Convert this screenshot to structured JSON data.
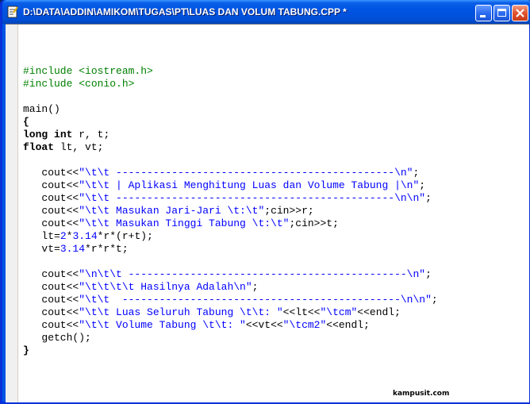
{
  "window": {
    "title": "D:\\DATA\\ADDIN\\AMIKOM\\TUGAS\\PT\\LUAS DAN VOLUM TABUNG.CPP *"
  },
  "titlebar_buttons": {
    "minimize": "minimize-icon",
    "maximize": "maximize-icon",
    "close": "close-icon"
  },
  "code_lines": [
    [
      {
        "t": "#include <iostream.h>",
        "c": "pp"
      }
    ],
    [
      {
        "t": "#include <conio.h>",
        "c": "pp"
      }
    ],
    [],
    [
      {
        "t": "main()",
        "c": ""
      }
    ],
    [
      {
        "t": "{",
        "c": "kw"
      }
    ],
    [
      {
        "t": "long",
        "c": "kw"
      },
      {
        "t": " ",
        "c": ""
      },
      {
        "t": "int",
        "c": "kw"
      },
      {
        "t": " r, t;",
        "c": ""
      }
    ],
    [
      {
        "t": "float",
        "c": "kw"
      },
      {
        "t": " lt, vt;",
        "c": ""
      }
    ],
    [],
    [
      {
        "t": "   cout<<",
        "c": ""
      },
      {
        "t": "\"\\t\\t ---------------------------------------------\\n\"",
        "c": "str"
      },
      {
        "t": ";",
        "c": ""
      }
    ],
    [
      {
        "t": "   cout<<",
        "c": ""
      },
      {
        "t": "\"\\t\\t | Aplikasi Menghitung Luas dan Volume Tabung |\\n\"",
        "c": "str"
      },
      {
        "t": ";",
        "c": ""
      }
    ],
    [
      {
        "t": "   cout<<",
        "c": ""
      },
      {
        "t": "\"\\t\\t ---------------------------------------------\\n\\n\"",
        "c": "str"
      },
      {
        "t": ";",
        "c": ""
      }
    ],
    [
      {
        "t": "   cout<<",
        "c": ""
      },
      {
        "t": "\"\\t\\t Masukan Jari-Jari \\t:\\t\"",
        "c": "str"
      },
      {
        "t": ";cin>>r;",
        "c": ""
      }
    ],
    [
      {
        "t": "   cout<<",
        "c": ""
      },
      {
        "t": "\"\\t\\t Masukan Tinggi Tabung \\t:\\t\"",
        "c": "str"
      },
      {
        "t": ";cin>>t;",
        "c": ""
      }
    ],
    [
      {
        "t": "   lt=",
        "c": ""
      },
      {
        "t": "2",
        "c": "num"
      },
      {
        "t": "*",
        "c": ""
      },
      {
        "t": "3.14",
        "c": "num"
      },
      {
        "t": "*r*(r+t);",
        "c": ""
      }
    ],
    [
      {
        "t": "   vt=",
        "c": ""
      },
      {
        "t": "3.14",
        "c": "num"
      },
      {
        "t": "*r*r*t;",
        "c": ""
      }
    ],
    [],
    [
      {
        "t": "   cout<<",
        "c": ""
      },
      {
        "t": "\"\\n\\t\\t ---------------------------------------------\\n\"",
        "c": "str"
      },
      {
        "t": ";",
        "c": ""
      }
    ],
    [
      {
        "t": "   cout<<",
        "c": ""
      },
      {
        "t": "\"\\t\\t\\t\\t Hasilnya Adalah\\n\"",
        "c": "str"
      },
      {
        "t": ";",
        "c": ""
      }
    ],
    [
      {
        "t": "   cout<<",
        "c": ""
      },
      {
        "t": "\"\\t\\t  ---------------------------------------------\\n\\n\"",
        "c": "str"
      },
      {
        "t": ";",
        "c": ""
      }
    ],
    [
      {
        "t": "   cout<<",
        "c": ""
      },
      {
        "t": "\"\\t\\t Luas Seluruh Tabung \\t\\t: \"",
        "c": "str"
      },
      {
        "t": "<<lt<<",
        "c": ""
      },
      {
        "t": "\"\\tcm\"",
        "c": "str"
      },
      {
        "t": "<<endl;",
        "c": ""
      }
    ],
    [
      {
        "t": "   cout<<",
        "c": ""
      },
      {
        "t": "\"\\t\\t Volume Tabung \\t\\t: \"",
        "c": "str"
      },
      {
        "t": "<<vt<<",
        "c": ""
      },
      {
        "t": "\"\\tcm2\"",
        "c": "str"
      },
      {
        "t": "<<endl;",
        "c": ""
      }
    ],
    [
      {
        "t": "   getch();",
        "c": ""
      }
    ],
    [
      {
        "t": "}",
        "c": "kw"
      }
    ]
  ],
  "watermark": "kampusit.com"
}
